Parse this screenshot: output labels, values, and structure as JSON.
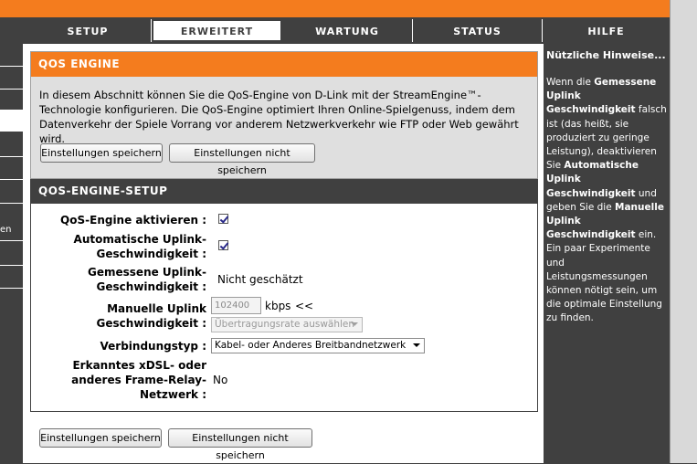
{
  "tabs": [
    "SETUP",
    "ERWEITERT",
    "WARTUNG",
    "STATUS",
    "HILFE"
  ],
  "leftnav": {
    "partial_label": "en"
  },
  "qos_engine": {
    "title": "QOS ENGINE",
    "description": "In diesem Abschnitt können Sie die QoS-Engine von D-Link mit der StreamEngine™-Technologie konfigurieren. Die QoS-Engine optimiert Ihren Online-Spielgenuss, indem dem Datenverkehr der Spiele Vorrang vor anderem Netzwerkverkehr wie FTP oder Web gewährt wird.",
    "save_label": "Einstellungen speichern",
    "dont_save_label": "Einstellungen nicht speichern"
  },
  "setup": {
    "title": "QOS-ENGINE-SETUP",
    "qos_enable_label": "QoS-Engine aktivieren :",
    "qos_enable_checked": true,
    "auto_uplink_label_1": "Automatische Uplink-",
    "auto_uplink_label_2": "Geschwindigkeit :",
    "auto_uplink_checked": true,
    "measured_label_1": "Gemessene Uplink-",
    "measured_label_2": "Geschwindigkeit :",
    "measured_value": "Nicht geschätzt",
    "manual_label_1": "Manuelle Uplink",
    "manual_label_2": "Geschwindigkeit :",
    "manual_value": "102400",
    "manual_unit": "kbps",
    "manual_arrow": "<<",
    "rate_placeholder": "Übertragungsrate auswählen",
    "connection_label": "Verbindungstyp :",
    "connection_value": "Kabel- oder Anderes Breitbandnetzwerk",
    "xdsl_label_1": "Erkanntes xDSL- oder",
    "xdsl_label_2": "anderes Frame-Relay-",
    "xdsl_label_3": "Netzwerk :",
    "xdsl_value": "No"
  },
  "bottom": {
    "save_label": "Einstellungen speichern",
    "dont_save_label": "Einstellungen nicht speichern"
  },
  "hints": {
    "title": "Nützliche Hinweise...",
    "t1": "Wenn die ",
    "b1": "Gemessene Uplink Geschwindigkeit",
    "t2": " falsch ist (das heißt, sie produziert zu geringe Leistung), deaktivieren Sie ",
    "b2": "Automatische Uplink Geschwindigkeit",
    "t3": " und geben Sie die ",
    "b3": "Manuelle Uplink Geschwindigkeit",
    "t4": " ein. Ein paar Experimente und Leistungsmessungen können nötigt sein, um die optimale Einstellung zu finden."
  }
}
